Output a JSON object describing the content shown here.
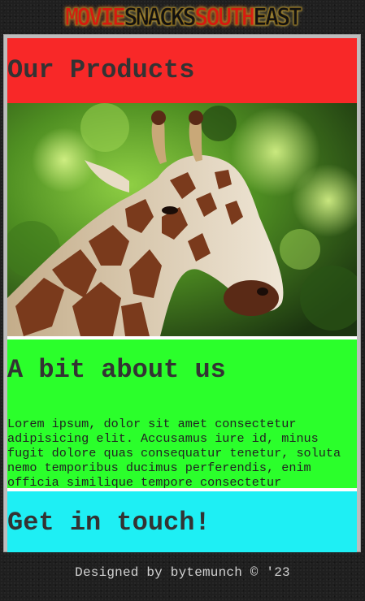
{
  "header": {
    "logo_words": [
      "MOVIE",
      "SNACKS",
      "SOUTH",
      "EAST"
    ],
    "logo_colors": [
      "#d81a10",
      "#111111",
      "#d81a10",
      "#111111"
    ]
  },
  "products": {
    "heading": "Our Products",
    "image_subject": "giraffe-photo"
  },
  "about": {
    "heading": "A bit about us",
    "body": "Lorem ipsum, dolor sit amet consectetur adipisicing elit. Accusamus iure id, minus fugit dolore quas consequatur tenetur, soluta nemo temporibus ducimus perferendis, enim officia similique tempore consectetur"
  },
  "contact": {
    "heading": "Get in touch!"
  },
  "footer": {
    "text": "Designed by bytemunch © '23"
  },
  "colors": {
    "products_bg": "#f82828",
    "about_bg": "#2bff2b",
    "contact_bg": "#1eeff4",
    "frame": "#bdbdbd",
    "page_bg": "#1f1f1f"
  }
}
